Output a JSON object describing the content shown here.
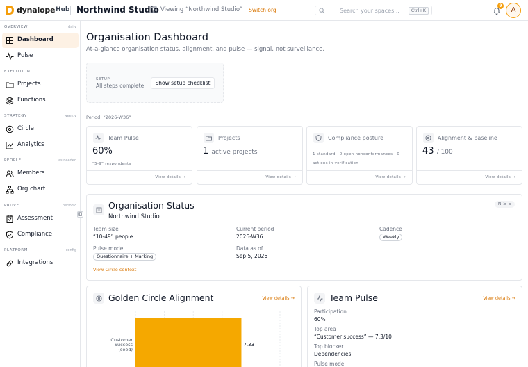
{
  "topbar": {
    "brand": "dynalope",
    "hub_label": "Hub",
    "org_name": "Northwind Studio",
    "viewing_text": "Viewing “Northwind Studio”",
    "switch_label": "Switch org",
    "search_placeholder": "Search your spaces...",
    "search_shortcut": "Ctrl+K",
    "notification_count": "9",
    "avatar_initial": "A",
    "accent_color": "#f59e0b"
  },
  "sidebar": {
    "sections": {
      "overview": {
        "title": "OVERVIEW",
        "hint": "daily"
      },
      "execution": {
        "title": "EXECUTION",
        "hint": ""
      },
      "strategy": {
        "title": "STRATEGY",
        "hint": "weekly"
      },
      "people": {
        "title": "PEOPLE",
        "hint": "as needed"
      },
      "prove": {
        "title": "PROVE",
        "hint": "periodic"
      },
      "platform": {
        "title": "PLATFORM",
        "hint": "config"
      }
    },
    "items": {
      "dashboard": {
        "label": "Dashboard",
        "icon": "home-icon",
        "active": true
      },
      "pulse": {
        "label": "Pulse",
        "icon": "pulse-icon"
      },
      "projects": {
        "label": "Projects",
        "icon": "folder-icon"
      },
      "functions": {
        "label": "Functions",
        "icon": "layers-icon"
      },
      "circle": {
        "label": "Circle",
        "icon": "target-icon"
      },
      "analytics": {
        "label": "Analytics",
        "icon": "chart-icon"
      },
      "members": {
        "label": "Members",
        "icon": "users-icon"
      },
      "org_chart": {
        "label": "Org chart",
        "icon": "network-icon"
      },
      "assessment": {
        "label": "Assessment",
        "icon": "clipboard-icon"
      },
      "compliance": {
        "label": "Compliance",
        "icon": "shield-icon"
      },
      "integrations": {
        "label": "Integrations",
        "icon": "link-icon"
      }
    }
  },
  "main": {
    "title": "Organisation Dashboard",
    "subtitle": "At-a-glance organisation status, alignment, and pulse — signal, not surveillance.",
    "setup": {
      "label": "SETUP",
      "status": "All steps complete.",
      "button": "Show setup checklist"
    },
    "period": "Period: “2026-W36”",
    "stats": {
      "team_pulse": {
        "title": "Team Pulse",
        "value": "60%",
        "note": "“5-9” respondents",
        "link": "View details →"
      },
      "projects": {
        "title": "Projects",
        "value": "1",
        "unit": "active projects",
        "link": "View details →"
      },
      "compliance": {
        "title": "Compliance posture",
        "note": "1 standard · 0 open nonconformances · 0 actions in verification",
        "link": "View details →"
      },
      "alignment": {
        "title": "Alignment & baseline",
        "value": "43",
        "unit": "/ 100",
        "link": "View details →"
      }
    },
    "org_status": {
      "title": "Organisation Status",
      "name": "Northwind Studio",
      "n_badge": "N ≥ 5",
      "team_size_label": "Team size",
      "team_size": "“10-49” people",
      "current_period_label": "Current period",
      "current_period": "2026-W36",
      "cadence_label": "Cadence",
      "cadence": "Weekly",
      "pulse_mode_label": "Pulse mode",
      "pulse_mode": "Questionnaire + Marking",
      "data_as_of_label": "Data as of",
      "data_as_of": "Sep 5, 2026",
      "link": "View Circle context"
    },
    "golden_circle": {
      "title": "Golden Circle Alignment",
      "link": "View details →"
    },
    "team_pulse_card": {
      "title": "Team Pulse",
      "link": "View details →",
      "participation_label": "Participation",
      "participation": "60%",
      "top_area_label": "Top area",
      "top_area": "“Customer success” — 7.3/10",
      "top_blocker_label": "Top blocker",
      "top_blocker": "Dependencies",
      "pulse_mode_label": "Pulse mode"
    }
  },
  "chart_data": {
    "type": "bar",
    "orientation": "horizontal",
    "categories": [
      "Customer Success (seed)"
    ],
    "values": [
      7.33
    ],
    "xlim": [
      0,
      10
    ],
    "grid": true,
    "bar_color": "#f5a800",
    "data_labels": [
      "7.33"
    ]
  }
}
